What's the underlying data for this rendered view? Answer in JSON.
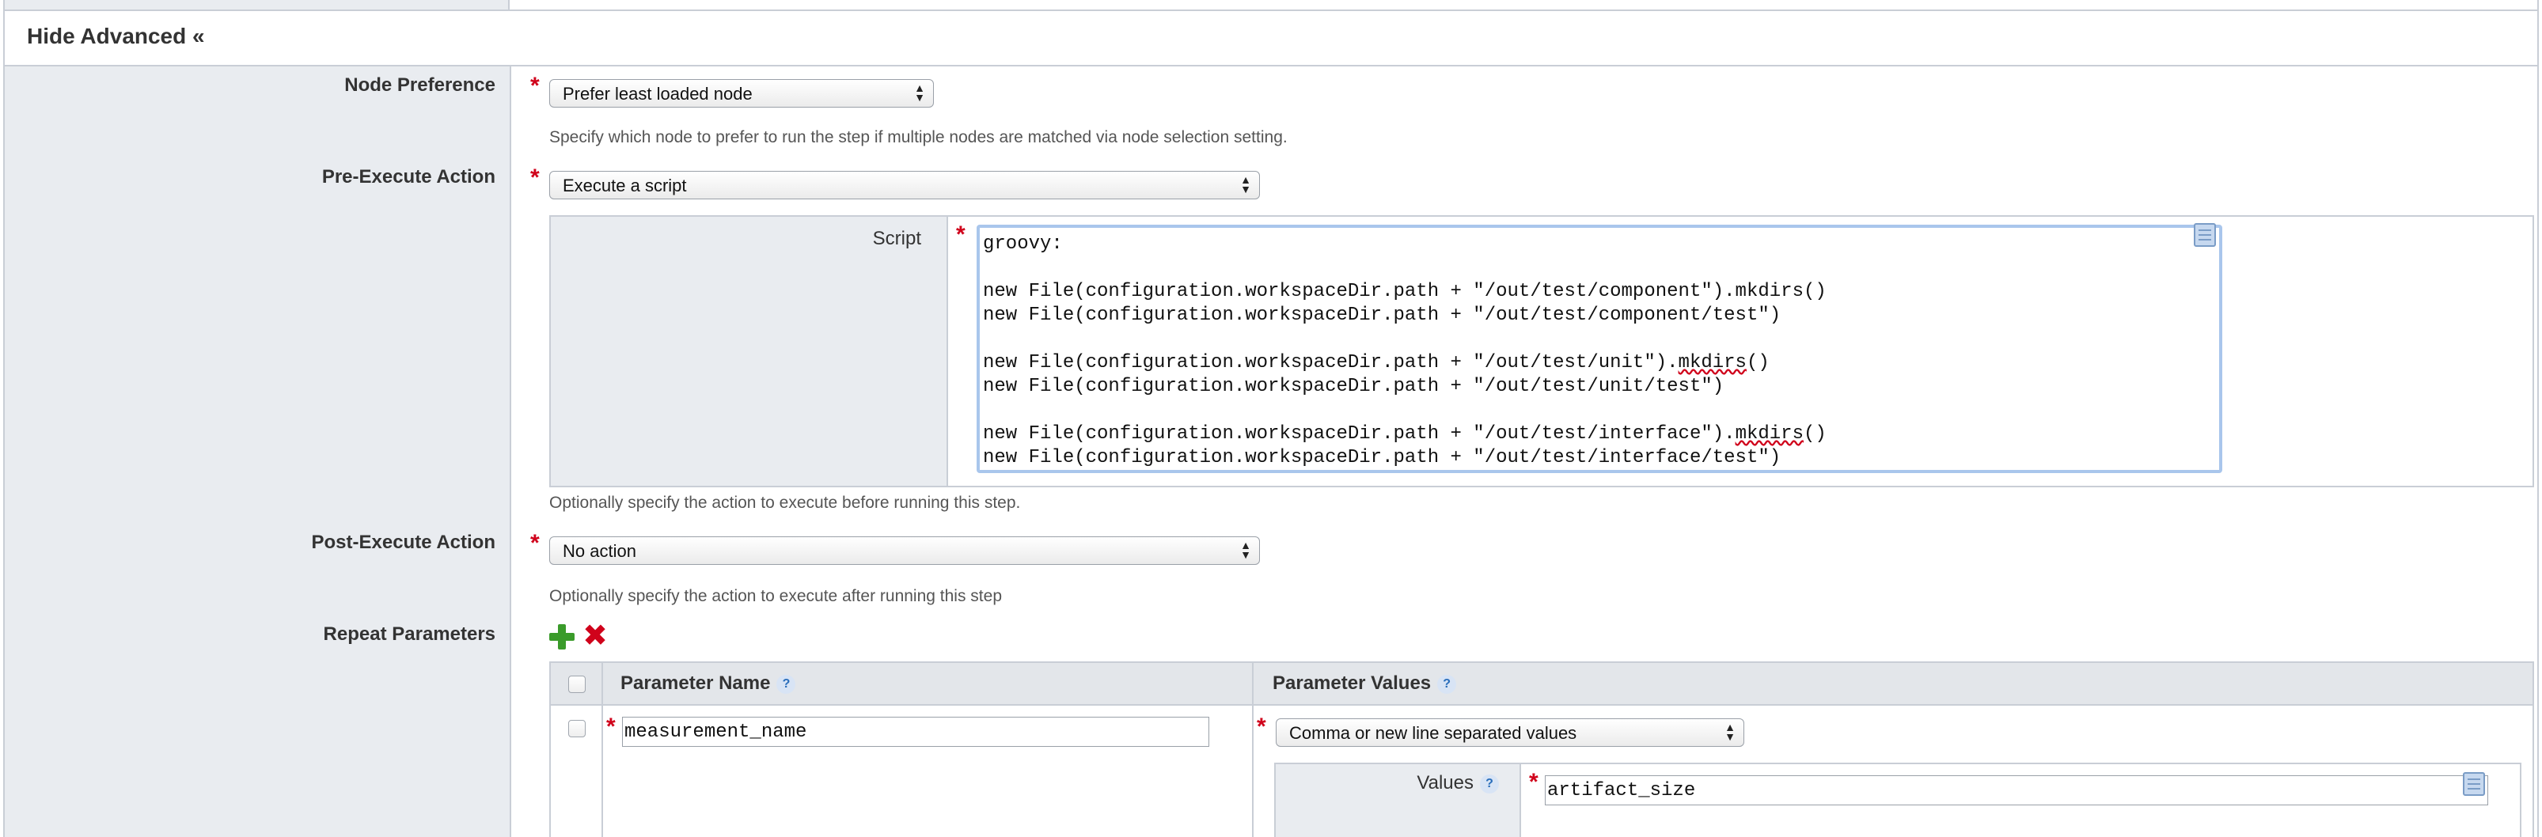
{
  "section": {
    "title": "Hide Advanced «"
  },
  "node_preference": {
    "label": "Node Preference",
    "value": "Prefer least loaded node",
    "help": "Specify which node to prefer to run the step if multiple nodes are matched via node selection setting."
  },
  "pre_execute": {
    "label": "Pre-Execute Action",
    "value": "Execute a script",
    "script_label": "Script",
    "script_lines": [
      "groovy:",
      "",
      "new File(configuration.workspaceDir.path + \"/out/test/component\").mkdirs()",
      "new File(configuration.workspaceDir.path + \"/out/test/component/test\")",
      "",
      "new File(configuration.workspaceDir.path + \"/out/test/unit\").mkdirs()",
      "new File(configuration.workspaceDir.path + \"/out/test/unit/test\")",
      "",
      "new File(configuration.workspaceDir.path + \"/out/test/interface\").mkdirs()",
      "new File(configuration.workspaceDir.path + \"/out/test/interface/test\")"
    ],
    "help": "Optionally specify the action to execute before running this step."
  },
  "post_execute": {
    "label": "Post-Execute Action",
    "value": "No action",
    "help": "Optionally specify the action to execute after running this step"
  },
  "repeat_parameters": {
    "label": "Repeat Parameters",
    "columns": [
      "Parameter Name",
      "Parameter Values"
    ],
    "help_glyph": "?",
    "row": {
      "name": "measurement_name",
      "values_type": "Comma or new line separated values",
      "values_label": "Values",
      "values": "artifact_size"
    }
  },
  "icons": {
    "add": "plus-icon",
    "delete": "delete-x-icon",
    "editor": "document-icon",
    "select_arrows": "updown-arrows-icon"
  },
  "colors": {
    "required": "#d0021b",
    "label_bg": "#e9ecf0",
    "add_green": "#3a9b2a",
    "focus_border": "#a9c6ec"
  }
}
